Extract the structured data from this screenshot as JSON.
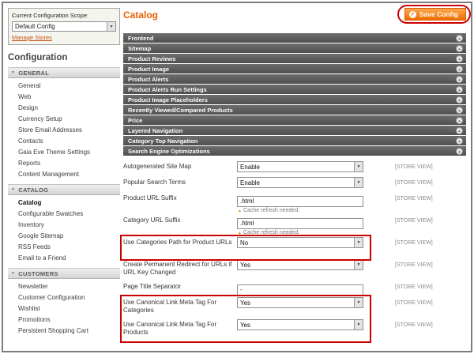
{
  "colors": {
    "accent_orange": "#eb5e00",
    "annotation_red": "#cc0000",
    "section_bar_gray": "#5f5f5f"
  },
  "icons": {
    "dropdown_arrow": "▼",
    "section_toggle": "▲",
    "nav_arrow": "▼",
    "warning": "▲",
    "save_check": "✓"
  },
  "scope_panel": {
    "label": "Current Configuration Scope:",
    "select_value": "Default Config",
    "link": "Manage Stores"
  },
  "sidebar": {
    "title": "Configuration",
    "selected_item": "Catalog",
    "groups": [
      {
        "label": "GENERAL",
        "items": [
          "General",
          "Web",
          "Design",
          "Currency Setup",
          "Store Email Addresses",
          "Contacts",
          "Gaia Eve Theme Settings",
          "Reports",
          "Content Management"
        ]
      },
      {
        "label": "CATALOG",
        "items": [
          "Catalog",
          "Configurable Swatches",
          "Inventory",
          "Google Sitemap",
          "RSS Feeds",
          "Email to a Friend"
        ]
      },
      {
        "label": "CUSTOMERS",
        "items": [
          "Newsletter",
          "Customer Configuration",
          "Wishlist",
          "Promotions",
          "Persistent Shopping Cart"
        ]
      }
    ]
  },
  "main": {
    "title": "Catalog",
    "save_button": "Save Config",
    "sections": [
      "Frontend",
      "Sitemap",
      "Product Reviews",
      "Product Image",
      "Product Alerts",
      "Product Alerts Run Settings",
      "Product Image Placeholders",
      "Recently Viewed/Compared Products",
      "Price",
      "Layered Navigation",
      "Category Top Navigation",
      "Search Engine Optimizations"
    ],
    "fields": [
      {
        "label": "Autogenerated Site Map",
        "control": "select",
        "value": "Enable",
        "scope": "[STORE VIEW]"
      },
      {
        "label": "Popular Search Terms",
        "control": "select",
        "value": "Enable",
        "scope": "[STORE VIEW]"
      },
      {
        "label": "Product URL Suffix",
        "control": "input",
        "value": ".html",
        "note": "Cache refresh needed.",
        "scope": "[STORE VIEW]"
      },
      {
        "label": "Category URL Suffix",
        "control": "input",
        "value": ".html",
        "note": "Cache refresh needed.",
        "scope": "[STORE VIEW]"
      },
      {
        "label": "Use Categories Path for Product URLs",
        "control": "select",
        "value": "No",
        "scope": "[STORE VIEW]"
      },
      {
        "label": "Create Permanent Redirect for URLs if URL Key Changed",
        "control": "select",
        "value": "Yes",
        "scope": "[STORE VIEW]"
      },
      {
        "label": "Page Title Separator",
        "control": "input",
        "value": "-",
        "scope": "[STORE VIEW]"
      },
      {
        "label": "Use Canonical Link Meta Tag For Categories",
        "control": "select",
        "value": "Yes",
        "scope": "[STORE VIEW]"
      },
      {
        "label": "Use Canonical Link Meta Tag For Products",
        "control": "select",
        "value": "Yes",
        "scope": "[STORE VIEW]"
      }
    ]
  }
}
